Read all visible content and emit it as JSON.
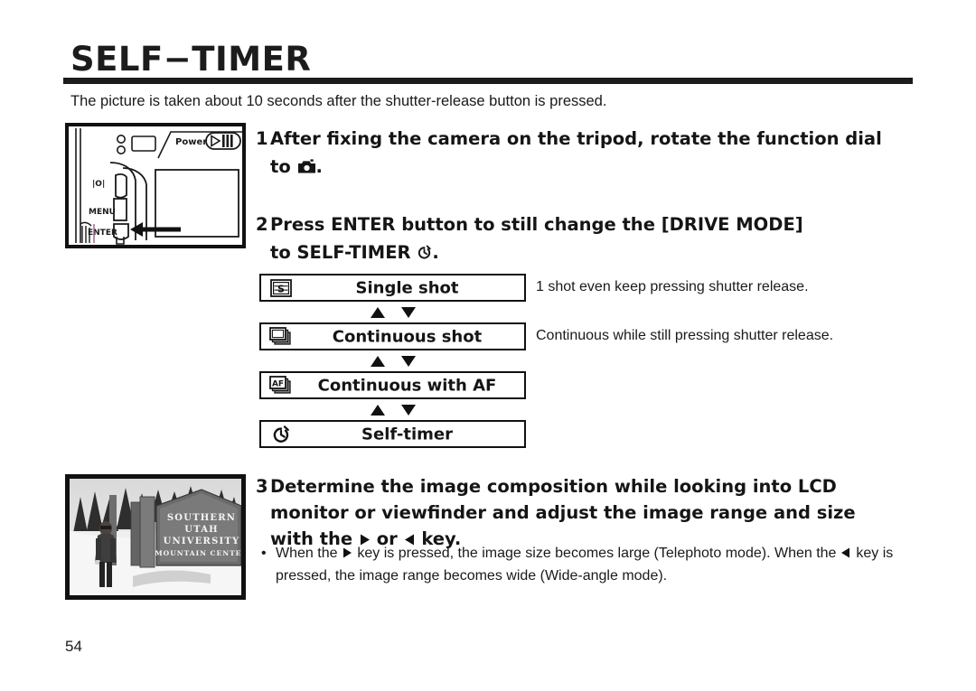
{
  "document": {
    "title": "SELF−TIMER",
    "intro": "The picture is taken about 10 seconds after the shutter-release button is pressed.",
    "page_number": "54"
  },
  "camera_figure": {
    "name": "camera-back-diagram",
    "power_label": "Power",
    "display_button_label": "|O|",
    "menu_button_label": "MENU",
    "enter_button_label": "ENTER"
  },
  "steps": [
    {
      "number": "1",
      "line1": "After fixing the camera on the tripod, rotate the function dial",
      "line2_prefix": "to",
      "line2_icon": "camera-icon",
      "line2_suffix": "."
    },
    {
      "number": "2",
      "line1": "Press ENTER button to still change the [DRIVE MODE]",
      "line2_prefix": "to SELF-TIMER",
      "line2_icon": "self-timer-icon",
      "line2_suffix": "."
    },
    {
      "number": "3",
      "line1": "Determine the image composition while looking into LCD",
      "line2": "monitor or viewfinder and adjust the image range and size",
      "line3_prefix": "with the",
      "line3_icon_right": "right-triangle-icon",
      "line3_mid": "or",
      "line3_icon_left": "left-triangle-icon",
      "line3_suffix": "key."
    }
  ],
  "drive_modes": [
    {
      "icon": "single-shot-icon",
      "label": "Single shot",
      "description": "1 shot even keep pressing shutter release."
    },
    {
      "icon": "continuous-shot-icon",
      "label": "Continuous shot",
      "description": "Continuous while still pressing shutter release."
    },
    {
      "icon": "continuous-af-icon",
      "label": "Continuous with AF",
      "description": ""
    },
    {
      "icon": "self-timer-icon",
      "label": "Self-timer",
      "description": ""
    }
  ],
  "mode_separator": {
    "up_icon": "up-triangle-icon",
    "down_icon": "down-triangle-icon"
  },
  "note": {
    "bullet": "•",
    "part1": "When the",
    "icon1": "right-triangle-icon",
    "part2": "key is pressed, the image size becomes large (Telephoto",
    "part3": "mode). When the",
    "icon2": "left-triangle-icon",
    "part4": "key is pressed, the image range becomes wide",
    "part5": "(Wide-angle mode)."
  },
  "photo": {
    "name": "sample-photo",
    "sign_lines": [
      "SOUTHERN",
      "UTAH",
      "UNIVERSITY",
      "MOUNTAIN CENTER"
    ]
  },
  "colors": {
    "ink": "#1a1a1a",
    "rule": "#1c1c1c",
    "paper": "#ffffff"
  }
}
